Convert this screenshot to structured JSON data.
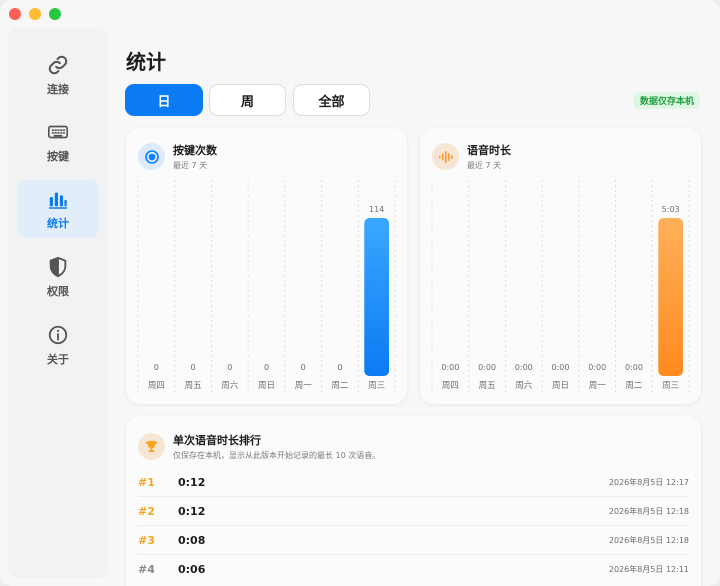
{
  "window": {
    "controls": [
      "close",
      "minimize",
      "maximize"
    ]
  },
  "sidebar": {
    "items": [
      {
        "label": "连接",
        "icon": "link-icon",
        "active": false
      },
      {
        "label": "按键",
        "icon": "keyboard-icon",
        "active": false
      },
      {
        "label": "统计",
        "icon": "bar-chart-icon",
        "active": true
      },
      {
        "label": "权限",
        "icon": "shield-icon",
        "active": false
      },
      {
        "label": "关于",
        "icon": "info-icon",
        "active": false
      }
    ]
  },
  "page": {
    "title": "统计"
  },
  "range_tabs": {
    "items": [
      "日",
      "周",
      "全部"
    ],
    "selected": "日"
  },
  "badge": {
    "label": "数据仅存本机",
    "color": "#22a043"
  },
  "keypress_card": {
    "title": "按键次数",
    "subtitle": "最近 7 天",
    "icon": "target-icon",
    "accent": "#0a84ff"
  },
  "voice_card": {
    "title": "语音时长",
    "subtitle": "最近 7 天",
    "icon": "waveform-icon",
    "accent": "#ff9a2e"
  },
  "chart_data": [
    {
      "type": "bar",
      "title": "按键次数",
      "subtitle": "最近 7 天",
      "categories": [
        "周四",
        "周五",
        "周六",
        "周日",
        "周一",
        "周二",
        "周三"
      ],
      "values": [
        0,
        0,
        0,
        0,
        0,
        0,
        114
      ],
      "data_labels": [
        "0",
        "0",
        "0",
        "0",
        "0",
        "0",
        "114"
      ],
      "ylim": [
        0,
        114
      ],
      "grid": true,
      "color": "#0a84ff"
    },
    {
      "type": "bar",
      "title": "语音时长",
      "subtitle": "最近 7 天",
      "categories": [
        "周四",
        "周五",
        "周六",
        "周日",
        "周一",
        "周二",
        "周三"
      ],
      "values": [
        0,
        0,
        0,
        0,
        0,
        0,
        303
      ],
      "data_labels": [
        "0:00",
        "0:00",
        "0:00",
        "0:00",
        "0:00",
        "0:00",
        "5:03"
      ],
      "ylim": [
        0,
        303
      ],
      "grid": true,
      "color": "#ff9a2e"
    }
  ],
  "ranking": {
    "title": "单次语音时长排行",
    "subtitle": "仅保存在本机，显示从此版本开始记录的最长 10 次语音。",
    "icon": "trophy-icon",
    "rows": [
      {
        "rank": "#1",
        "duration": "0:12",
        "date": "2026年8月5日 12:17"
      },
      {
        "rank": "#2",
        "duration": "0:12",
        "date": "2026年8月5日 12:18"
      },
      {
        "rank": "#3",
        "duration": "0:08",
        "date": "2026年8月5日 12:18"
      },
      {
        "rank": "#4",
        "duration": "0:06",
        "date": "2026年8月5日 12:11"
      }
    ]
  }
}
